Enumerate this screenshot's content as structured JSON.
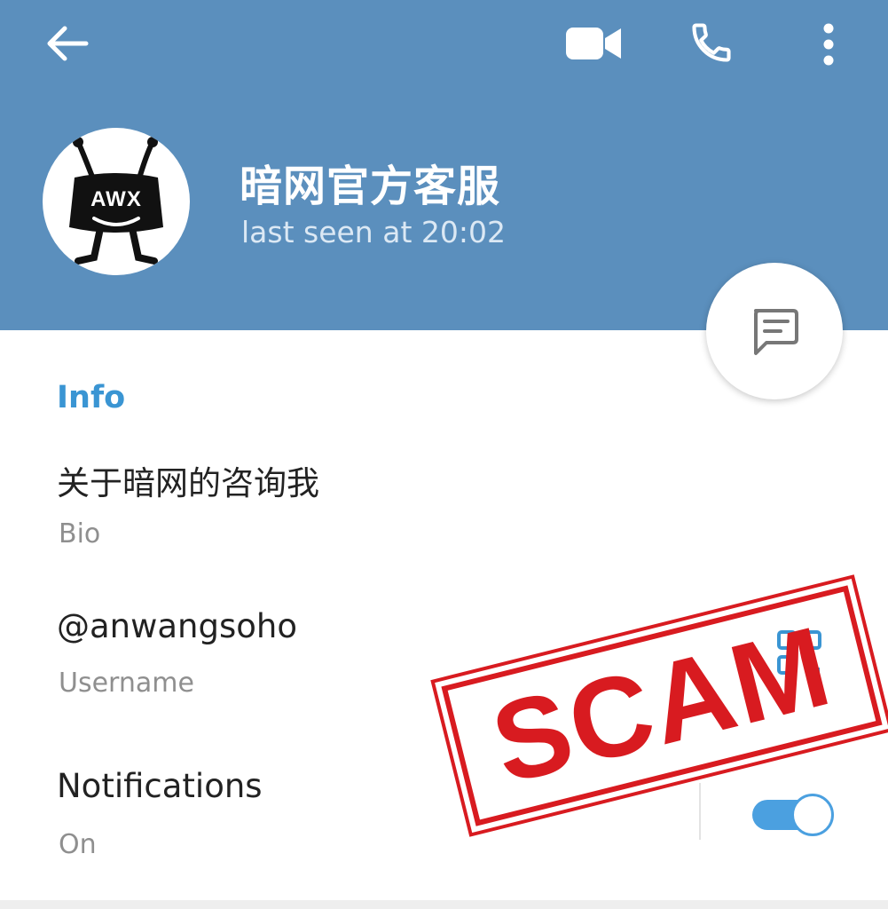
{
  "header": {
    "name": "暗网官方客服",
    "status": "last seen at 20:02",
    "avatar_text": "AWX",
    "bg_color": "#5b8fbd",
    "icons": [
      "back-arrow-icon",
      "video-call-icon",
      "phone-icon",
      "more-vertical-icon"
    ]
  },
  "fab": {
    "icon": "message-icon"
  },
  "info": {
    "heading": "Info",
    "bio": {
      "value": "关于暗网的咨询我",
      "label": "Bio"
    },
    "username": {
      "value": "@anwangsoho",
      "label": "Username"
    },
    "notifications": {
      "value": "Notifications",
      "label": "On",
      "enabled": true
    }
  },
  "stamp": {
    "text": "SCAM",
    "color": "#d81b20"
  },
  "accent_color": "#3a95d3"
}
